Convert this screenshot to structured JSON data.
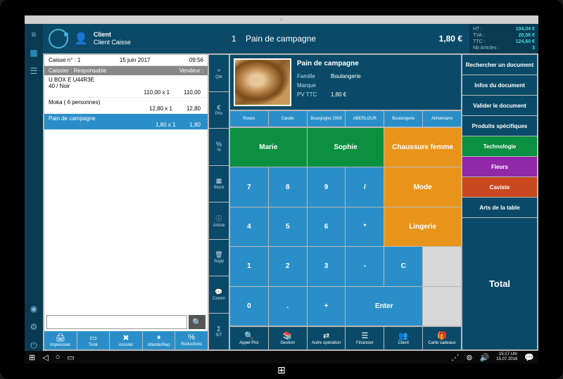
{
  "header": {
    "client_label": "Client",
    "client_name": "Client Caisse",
    "item_qty": "1",
    "item_name": "Pain de campagne",
    "item_price": "1,80 €",
    "totals": {
      "ht_label": "HT :",
      "ht": "104,04 €",
      "tva_label": "TVA :",
      "tva": "20,56 €",
      "ttc_label": "TTC :",
      "ttc": "124,60 €",
      "nb_label": "Nb Articles :",
      "nb": "3"
    }
  },
  "ticket": {
    "caisse": "Caisse n° : 1",
    "date": "15 juin 2017",
    "time": "09:56",
    "cashier_label": "Caissier : Responsable",
    "vendor_label": "Vendeur :",
    "lines": [
      {
        "name": "U BOX E U44R3E",
        "sub": "40 / Noir",
        "unit": "110,00  x  1",
        "total": "110,00"
      },
      {
        "name": "Moka ( 6 personnes)",
        "sub": "",
        "unit": "12,80  x  1",
        "total": "12,80"
      },
      {
        "name": "Pain de campagne",
        "sub": "",
        "unit": "1,80  x  1",
        "total": "1,80"
      }
    ],
    "search_placeholder": "",
    "actions": [
      "Impression",
      "Tiroir",
      "Annuler",
      "Attente/Rep",
      "Réductions"
    ]
  },
  "toolcol": [
    "Qté",
    "Prix",
    "%",
    "Stock",
    "Article",
    "Supp",
    "Comm",
    "S/T"
  ],
  "product": {
    "name": "Pain de campagne",
    "family_label": "Famille",
    "family": "Boulangerie",
    "brand_label": "Marque",
    "brand": "",
    "price_label": "PV TTC",
    "price": "1,80 €"
  },
  "cats": [
    "Roses",
    "Carafe",
    "Bourgogne 2009",
    "ABERLOUR",
    "Boulangerie",
    "Alimentaire"
  ],
  "grid_row1": [
    {
      "label": "Marie",
      "cls": "green wide2"
    },
    {
      "label": "Sophie",
      "cls": "green wide2"
    },
    {
      "label": "Chaussure femme",
      "cls": "orange wide2"
    }
  ],
  "grid_keys": [
    [
      "7",
      "8",
      "9",
      "/"
    ],
    [
      "4",
      "5",
      "6",
      "*",
      "C"
    ],
    [
      "1",
      "2",
      "3",
      "-"
    ],
    [
      "0",
      ".",
      "+"
    ]
  ],
  "grid_side": [
    {
      "label": "Mode",
      "cls": "orange"
    },
    {
      "label": "Lingerie",
      "cls": "orange"
    }
  ],
  "enter": "Enter",
  "bottom": [
    "Appel Prix",
    "Gestion",
    "Autre opération",
    "Financier",
    "Client",
    "Carte cadeaux"
  ],
  "right": [
    {
      "label": "Rechercher un document",
      "cls": "h3"
    },
    {
      "label": "Infos du document",
      "cls": "h3"
    },
    {
      "label": "Valider le document",
      "cls": "h3"
    },
    {
      "label": "Produits spécifiques",
      "cls": "h3"
    },
    {
      "label": "Technologie",
      "cls": "h3 tech"
    },
    {
      "label": "Fleurs",
      "cls": "h3 fleur"
    },
    {
      "label": "Caviste",
      "cls": "h3 cav"
    },
    {
      "label": "Arts de la table",
      "cls": "h3"
    },
    {
      "label": "Total",
      "cls": "total"
    }
  ],
  "taskbar": {
    "time": "15:17 Uhr",
    "date": "15.07.2016"
  }
}
